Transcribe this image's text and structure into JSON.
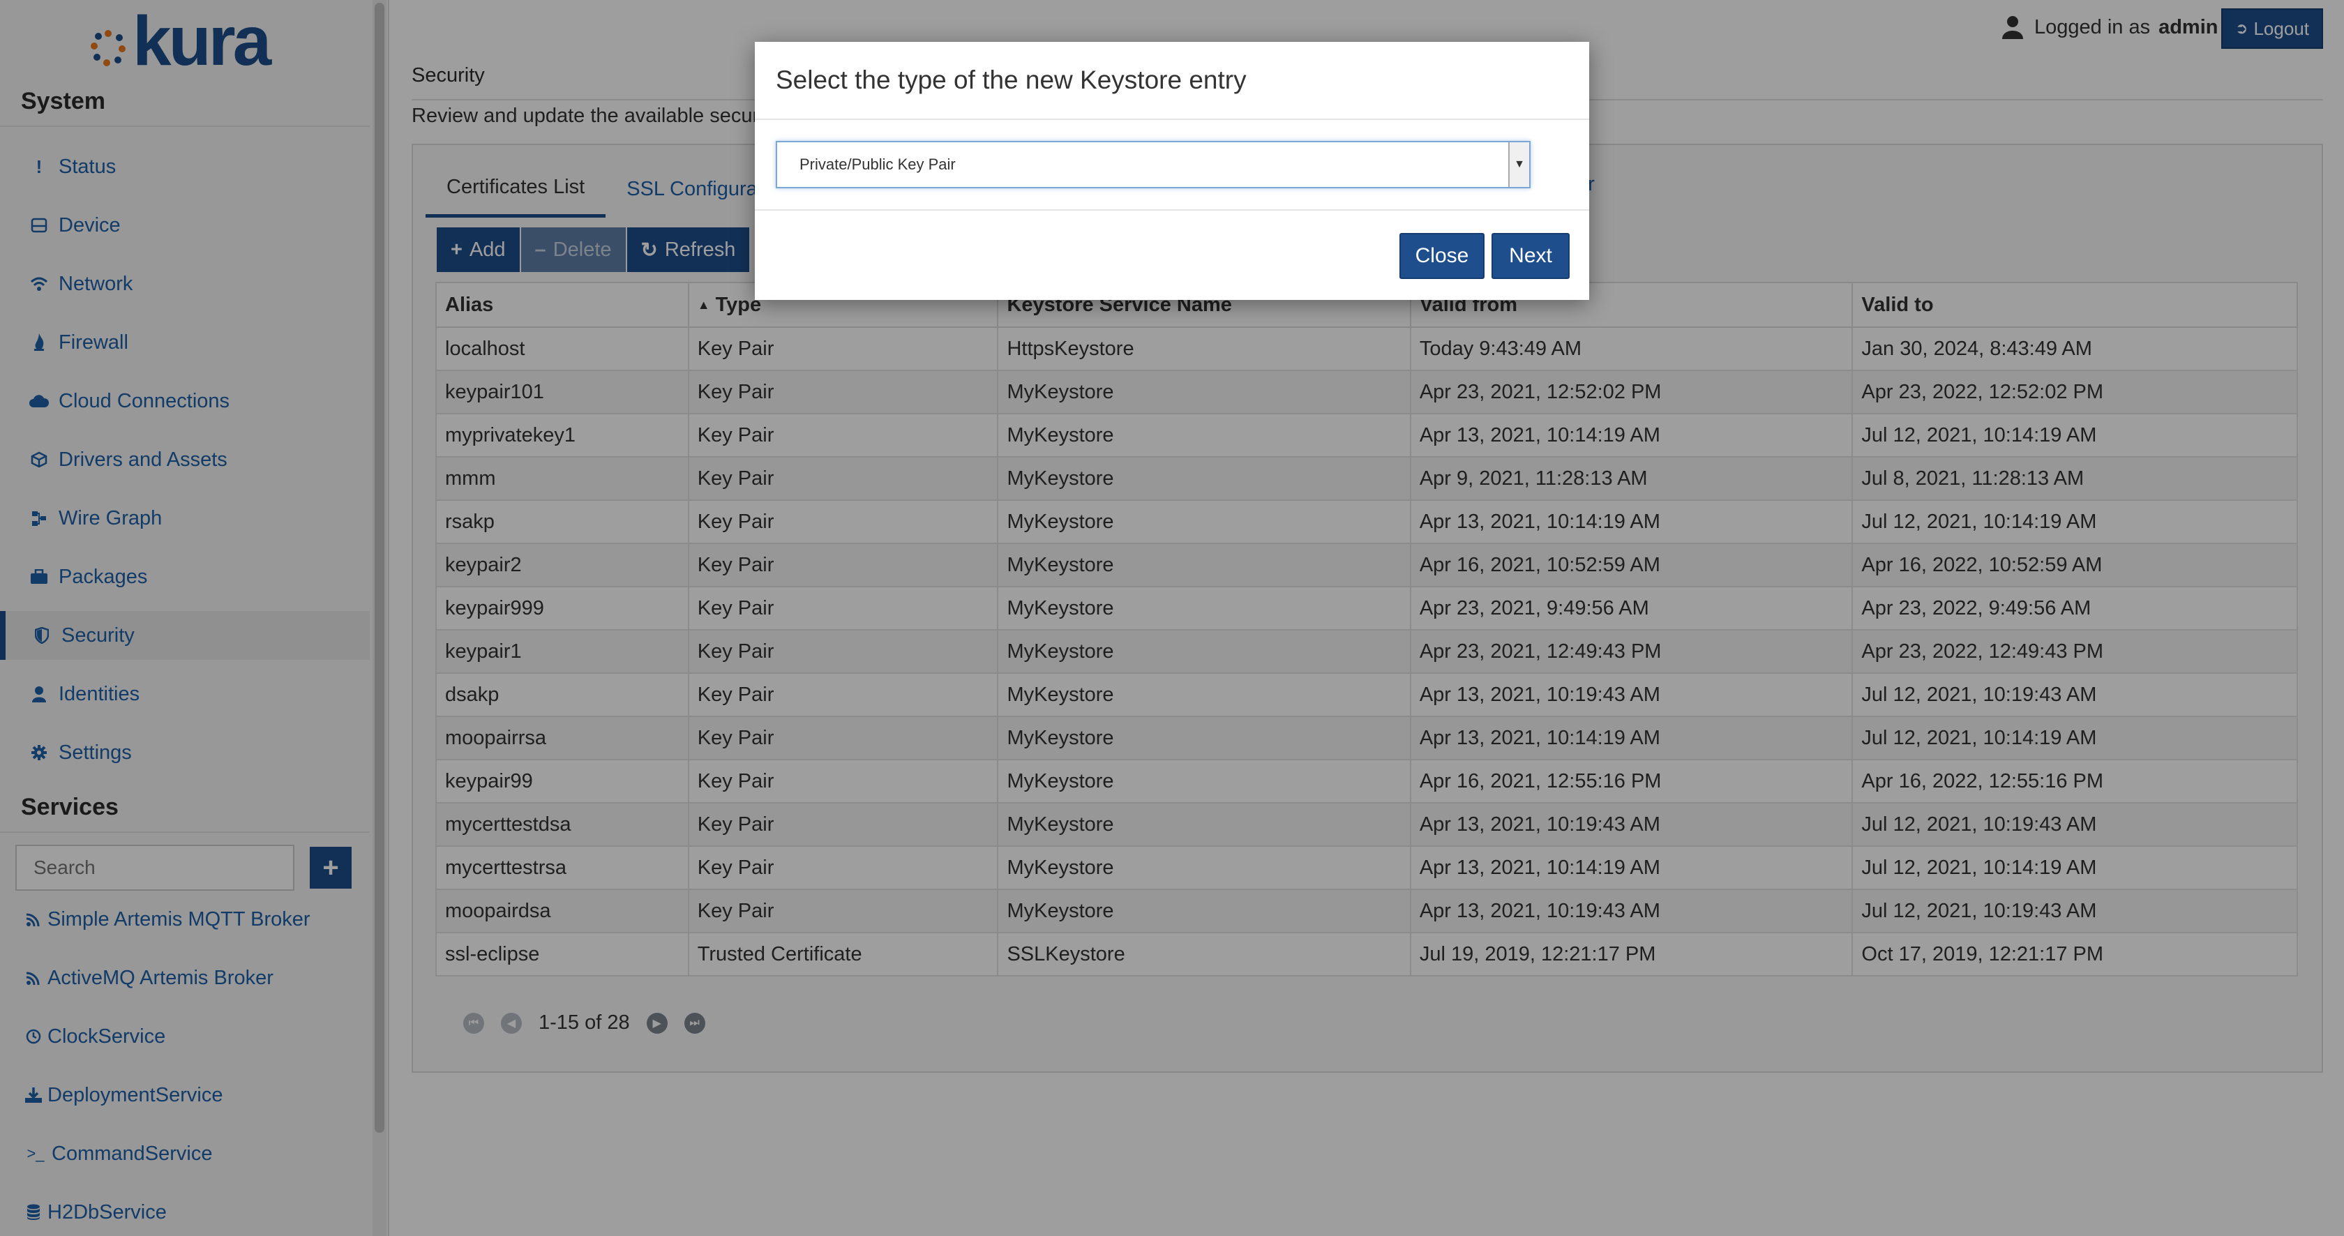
{
  "app": {
    "logo_text": "kura"
  },
  "user": {
    "logged_in_label": "Logged in as",
    "username": "admin",
    "logout_label": "Logout"
  },
  "sidebar": {
    "system_title": "System",
    "items": [
      {
        "label": "Status",
        "icon": "exclamation-icon"
      },
      {
        "label": "Device",
        "icon": "device-icon"
      },
      {
        "label": "Network",
        "icon": "wifi-icon"
      },
      {
        "label": "Firewall",
        "icon": "fire-icon"
      },
      {
        "label": "Cloud Connections",
        "icon": "cloud-icon"
      },
      {
        "label": "Drivers and Assets",
        "icon": "cube-icon"
      },
      {
        "label": "Wire Graph",
        "icon": "sitemap-icon"
      },
      {
        "label": "Packages",
        "icon": "briefcase-icon"
      },
      {
        "label": "Security",
        "icon": "shield-icon"
      },
      {
        "label": "Identities",
        "icon": "user-icon"
      },
      {
        "label": "Settings",
        "icon": "gear-icon"
      }
    ],
    "services_title": "Services",
    "search_placeholder": "Search",
    "services": [
      {
        "label": "Simple Artemis MQTT Broker",
        "icon": "rss-icon"
      },
      {
        "label": "ActiveMQ Artemis Broker",
        "icon": "rss-icon"
      },
      {
        "label": "ClockService",
        "icon": "clock-icon"
      },
      {
        "label": "DeploymentService",
        "icon": "download-icon"
      },
      {
        "label": "CommandService",
        "icon": "terminal-icon"
      },
      {
        "label": "H2DbService",
        "icon": "database-icon"
      }
    ]
  },
  "page": {
    "title": "Security",
    "description": "Review and update the available securi",
    "tabs": [
      "Certificates List",
      "SSL Configura"
    ],
    "tab_extra": "er",
    "toolbar": {
      "add": "Add",
      "delete": "Delete",
      "refresh": "Refresh"
    }
  },
  "table": {
    "columns": [
      "Alias",
      "Type",
      "Keystore Service Name",
      "Valid from",
      "Valid to"
    ],
    "rows": [
      [
        "localhost",
        "Key Pair",
        "HttpsKeystore",
        "Today 9:43:49 AM",
        "Jan 30, 2024, 8:43:49 AM"
      ],
      [
        "keypair101",
        "Key Pair",
        "MyKeystore",
        "Apr 23, 2021, 12:52:02 PM",
        "Apr 23, 2022, 12:52:02 PM"
      ],
      [
        "myprivatekey1",
        "Key Pair",
        "MyKeystore",
        "Apr 13, 2021, 10:14:19 AM",
        "Jul 12, 2021, 10:14:19 AM"
      ],
      [
        "mmm",
        "Key Pair",
        "MyKeystore",
        "Apr 9, 2021, 11:28:13 AM",
        "Jul 8, 2021, 11:28:13 AM"
      ],
      [
        "rsakp",
        "Key Pair",
        "MyKeystore",
        "Apr 13, 2021, 10:14:19 AM",
        "Jul 12, 2021, 10:14:19 AM"
      ],
      [
        "keypair2",
        "Key Pair",
        "MyKeystore",
        "Apr 16, 2021, 10:52:59 AM",
        "Apr 16, 2022, 10:52:59 AM"
      ],
      [
        "keypair999",
        "Key Pair",
        "MyKeystore",
        "Apr 23, 2021, 9:49:56 AM",
        "Apr 23, 2022, 9:49:56 AM"
      ],
      [
        "keypair1",
        "Key Pair",
        "MyKeystore",
        "Apr 23, 2021, 12:49:43 PM",
        "Apr 23, 2022, 12:49:43 PM"
      ],
      [
        "dsakp",
        "Key Pair",
        "MyKeystore",
        "Apr 13, 2021, 10:19:43 AM",
        "Jul 12, 2021, 10:19:43 AM"
      ],
      [
        "moopairrsa",
        "Key Pair",
        "MyKeystore",
        "Apr 13, 2021, 10:14:19 AM",
        "Jul 12, 2021, 10:14:19 AM"
      ],
      [
        "keypair99",
        "Key Pair",
        "MyKeystore",
        "Apr 16, 2021, 12:55:16 PM",
        "Apr 16, 2022, 12:55:16 PM"
      ],
      [
        "mycerttestdsa",
        "Key Pair",
        "MyKeystore",
        "Apr 13, 2021, 10:19:43 AM",
        "Jul 12, 2021, 10:19:43 AM"
      ],
      [
        "mycerttestrsa",
        "Key Pair",
        "MyKeystore",
        "Apr 13, 2021, 10:14:19 AM",
        "Jul 12, 2021, 10:14:19 AM"
      ],
      [
        "moopairdsa",
        "Key Pair",
        "MyKeystore",
        "Apr 13, 2021, 10:19:43 AM",
        "Jul 12, 2021, 10:19:43 AM"
      ],
      [
        "ssl-eclipse",
        "Trusted Certificate",
        "SSLKeystore",
        "Jul 19, 2019, 12:21:17 PM",
        "Oct 17, 2019, 12:21:17 PM"
      ]
    ],
    "pager_text": "1-15 of 28"
  },
  "modal": {
    "title": "Select the type of the new Keystore entry",
    "selected_option": "Private/Public Key Pair",
    "close_label": "Close",
    "next_label": "Next"
  },
  "colors": {
    "brand": "#1e4e8c",
    "link": "#1e5fa8"
  }
}
